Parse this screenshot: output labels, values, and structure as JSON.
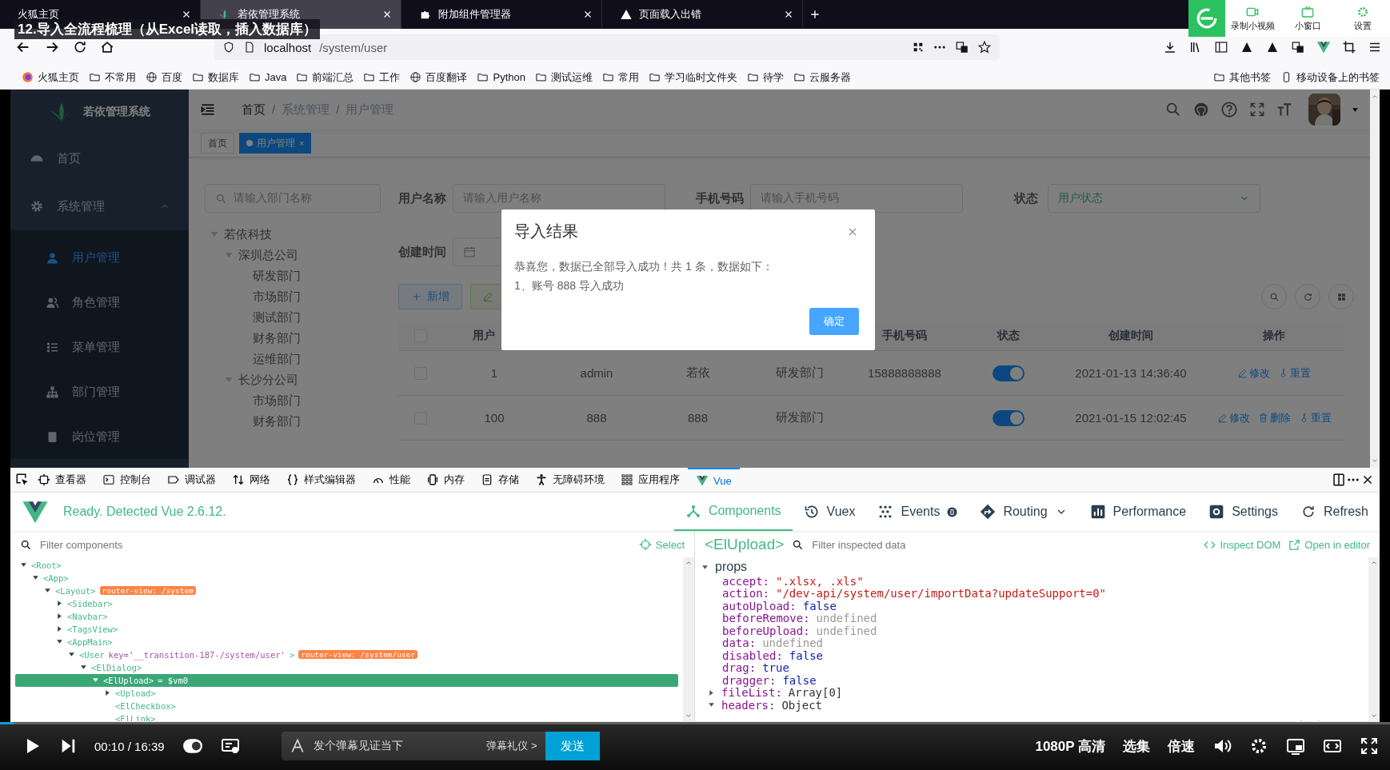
{
  "video_title": "12.导入全流程梳理（从Excel读取，插入数据库）",
  "player_overlay": [
    {
      "label": "录制小视频"
    },
    {
      "label": "小窗口"
    },
    {
      "label": "设置"
    }
  ],
  "browser": {
    "tabs": [
      {
        "title": "火狐主页",
        "selected": false
      },
      {
        "title": "若依管理系统",
        "selected": true
      },
      {
        "title": "附加组件管理器",
        "selected": false
      },
      {
        "title": "页面载入出错",
        "selected": false
      }
    ],
    "url": {
      "host": "localhost",
      "path": "/system/user"
    },
    "bookmarks": [
      {
        "label": "火狐主页",
        "kind": "firefox"
      },
      {
        "label": "不常用",
        "kind": "folder"
      },
      {
        "label": "百度",
        "kind": "site"
      },
      {
        "label": "数据库",
        "kind": "folder"
      },
      {
        "label": "Java",
        "kind": "folder"
      },
      {
        "label": "前端汇总",
        "kind": "folder"
      },
      {
        "label": "工作",
        "kind": "folder"
      },
      {
        "label": "百度翻译",
        "kind": "site"
      },
      {
        "label": "Python",
        "kind": "folder"
      },
      {
        "label": "测试运维",
        "kind": "folder"
      },
      {
        "label": "常用",
        "kind": "folder"
      },
      {
        "label": "学习临时文件夹",
        "kind": "folder"
      },
      {
        "label": "待学",
        "kind": "folder"
      },
      {
        "label": "云服务器",
        "kind": "folder"
      }
    ],
    "other_bookmarks": [
      {
        "label": "其他书签",
        "kind": "folder"
      },
      {
        "label": "移动设备上的书签",
        "kind": "mobile"
      }
    ]
  },
  "app": {
    "logo_title": "若依管理系统",
    "sidebar": [
      {
        "label": "首页",
        "kind": "item",
        "selected": false
      },
      {
        "label": "系统管理",
        "kind": "group",
        "expanded": true,
        "children": [
          {
            "label": "用户管理",
            "selected": true
          },
          {
            "label": "角色管理",
            "selected": false
          },
          {
            "label": "菜单管理",
            "selected": false
          },
          {
            "label": "部门管理",
            "selected": false
          },
          {
            "label": "岗位管理",
            "selected": false
          }
        ]
      }
    ],
    "breadcrumb": [
      {
        "text": "首页",
        "kind": "link"
      },
      {
        "text": "/",
        "kind": "separator"
      },
      {
        "text": "系统管理",
        "kind": "text"
      },
      {
        "text": "/",
        "kind": "separator"
      },
      {
        "text": "用户管理",
        "kind": "text"
      }
    ],
    "tags": [
      {
        "label": "首页",
        "selected": false
      },
      {
        "label": "用户管理",
        "selected": true,
        "close": "×"
      }
    ],
    "dept_search": {
      "placeholder": "请输入部门名称"
    },
    "dept_tree": [
      {
        "label": "若依科技",
        "expanded": true,
        "children": [
          {
            "label": "深圳总公司",
            "expanded": true,
            "children": [
              {
                "label": "研发部门"
              },
              {
                "label": "市场部门"
              },
              {
                "label": "测试部门"
              },
              {
                "label": "财务部门"
              },
              {
                "label": "运维部门"
              }
            ]
          },
          {
            "label": "长沙分公司",
            "expanded": true,
            "children": [
              {
                "label": "市场部门"
              },
              {
                "label": "财务部门"
              }
            ]
          }
        ]
      }
    ],
    "filters": [
      {
        "label": "用户名称",
        "placeholder": "请输入用户名称",
        "kind": "input"
      },
      {
        "label": "手机号码",
        "placeholder": "请输入手机号码",
        "kind": "input"
      },
      {
        "label": "状态",
        "placeholder": "用户状态",
        "kind": "select"
      },
      {
        "label": "创建时间",
        "kind": "daterange"
      }
    ],
    "buttons": [
      {
        "label": "新增",
        "kind": "primary"
      },
      {
        "kind": "success"
      }
    ],
    "table": {
      "columns": [
        {
          "kind": "check",
          "checked": false
        },
        {
          "label": "用户",
          "kind": "cut"
        },
        {
          "kind": "hidden"
        },
        {
          "kind": "hidden"
        },
        {
          "kind": "hidden"
        },
        {
          "label": "手机号码",
          "kind": "text"
        },
        {
          "label": "状态",
          "kind": "text"
        },
        {
          "label": "创建时间",
          "kind": "text"
        },
        {
          "label": "操作",
          "kind": "text"
        }
      ],
      "rows": [
        {
          "checked": false,
          "id": "1",
          "username": "admin",
          "nickname": "若依",
          "dept": "研发部门",
          "phone": "15888888888",
          "status_on": true,
          "created": "2021-01-13 14:36:40",
          "actions": [
            {
              "label": "修改",
              "kind": "edit"
            },
            {
              "label": "重置",
              "kind": "key"
            }
          ]
        },
        {
          "checked": false,
          "id": "100",
          "username": "888",
          "nickname": "888",
          "dept": "研发部门",
          "status_on": true,
          "created": "2021-01-15 12:02:45",
          "actions": [
            {
              "label": "修改",
              "kind": "edit"
            },
            {
              "label": "删除",
              "kind": "delete"
            },
            {
              "label": "重置",
              "kind": "key"
            }
          ]
        }
      ]
    },
    "modal": {
      "title": "导入结果",
      "lines": [
        "恭喜您，数据已全部导入成功！共 1 条，数据如下：",
        "1、账号 888 导入成功"
      ],
      "ok": "确定"
    }
  },
  "devtools": {
    "tools": [
      {
        "label": "查看器",
        "selected": false
      },
      {
        "label": "控制台",
        "selected": false
      },
      {
        "label": "调试器",
        "selected": false
      },
      {
        "label": "网络",
        "selected": false
      },
      {
        "label": "样式编辑器",
        "selected": false
      },
      {
        "label": "性能",
        "selected": false
      },
      {
        "label": "内存",
        "selected": false
      },
      {
        "label": "存储",
        "selected": false
      },
      {
        "label": "无障碍环境",
        "selected": false
      },
      {
        "label": "应用程序",
        "selected": false
      },
      {
        "label": "Vue",
        "selected": true
      }
    ],
    "vue": {
      "status": "Ready. Detected Vue 2.6.12.",
      "nav": [
        {
          "label": "Components",
          "selected": true
        },
        {
          "label": "Vuex",
          "selected": false
        },
        {
          "label": "Events",
          "selected": false
        },
        {
          "label": "Routing",
          "selected": false
        },
        {
          "label": "Performance",
          "selected": false
        },
        {
          "label": "Settings",
          "selected": false
        },
        {
          "label": "Refresh",
          "selected": false
        }
      ],
      "filter_placeholder": "Filter components",
      "select": "Select",
      "inspected": "<ElUpload>",
      "inspect_placeholder": "Filter inspected data",
      "inspect_dom": "Inspect DOM",
      "open_in_editor": "Open in editor",
      "tree": [
        {
          "name": "<Root>",
          "selected": false,
          "expanded": true,
          "children": [
            {
              "name": "<App>",
              "selected": false,
              "expanded": true,
              "children": [
                {
                  "name": "<Layout>",
                  "badge": "router-view: /system",
                  "selected": false,
                  "expanded": true,
                  "children": [
                    {
                      "name": "<Sidebar>",
                      "selected": false,
                      "expanded": false
                    },
                    {
                      "name": "<Navbar>",
                      "selected": false,
                      "expanded": false
                    },
                    {
                      "name": "<TagsView>",
                      "selected": false,
                      "expanded": false
                    },
                    {
                      "name": "<AppMain>",
                      "selected": false,
                      "expanded": true,
                      "children": [
                        {
                          "name": "<User",
                          "attr": "key='__transition-187-/system/user'",
                          "close": ">",
                          "badge": "router-view: /system/user",
                          "selected": false,
                          "expanded": true,
                          "children": [
                            {
                              "name": "<ElDialog>",
                              "selected": false,
                              "expanded": true,
                              "children": [
                                {
                                  "name": "<ElUpload>",
                                  "suffix": "= $vm0",
                                  "selected": true,
                                  "expanded": true,
                                  "children": [
                                    {
                                      "name": "<Upload>",
                                      "selected": false,
                                      "expanded": false
                                    },
                                    {
                                      "name": "<ElCheckbox>",
                                      "selected": false
                                    },
                                    {
                                      "name": "<ElLink>",
                                      "selected": false
                                    }
                                  ]
                                }
                              ]
                            }
                          ]
                        }
                      ]
                    }
                  ]
                }
              ]
            }
          ]
        }
      ],
      "section": {
        "label": "props",
        "expanded": true
      },
      "props": [
        {
          "key": "accept:",
          "value": "\".xlsx, .xls\"",
          "kind": "string"
        },
        {
          "key": "action:",
          "value": "\"/dev-api/system/user/importData?updateSupport=0\"",
          "kind": "string"
        },
        {
          "key": "autoUpload:",
          "value": "false",
          "kind": "literal"
        },
        {
          "key": "beforeRemove:",
          "value": "undefined",
          "kind": "undefined"
        },
        {
          "key": "beforeUpload:",
          "value": "undefined",
          "kind": "undefined"
        },
        {
          "key": "data:",
          "value": "undefined",
          "kind": "undefined"
        },
        {
          "key": "disabled:",
          "value": "false",
          "kind": "literal"
        },
        {
          "key": "drag:",
          "value": "true",
          "kind": "literal"
        },
        {
          "key": "dragger:",
          "value": "false",
          "kind": "literal"
        },
        {
          "key": "fileList:",
          "value": "Array[0]",
          "kind": "object",
          "expanded": false
        },
        {
          "key": "headers:",
          "value": "Object",
          "kind": "object",
          "expanded": true
        }
      ]
    }
  },
  "player": {
    "progress": {
      "level": 0.01
    },
    "time": "00:10 / 16:39",
    "danmaku_placeholder": "发个弹幕见证当下",
    "etiquette": "弹幕礼仪 >",
    "send": "发送",
    "quality": "1080P 高清",
    "episodes": "选集",
    "speed": "倍速"
  }
}
